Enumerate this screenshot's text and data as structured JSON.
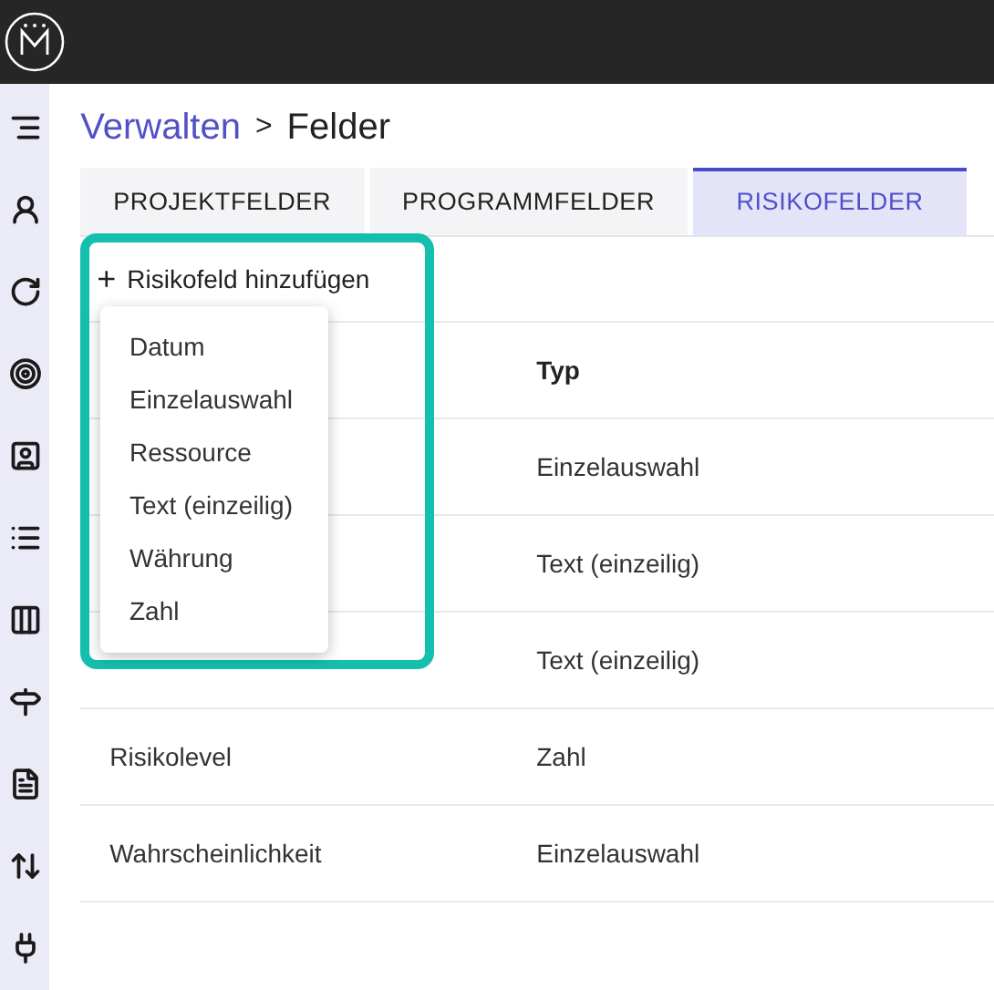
{
  "breadcrumb": {
    "parent": "Verwalten",
    "separator": ">",
    "current": "Felder"
  },
  "tabs": [
    {
      "label": "PROJEKTFELDER",
      "selected": false
    },
    {
      "label": "PROGRAMMFELDER",
      "selected": false
    },
    {
      "label": "RISIKOFELDER",
      "selected": true
    }
  ],
  "add_button": {
    "icon": "+",
    "label": "Risikofeld hinzufügen"
  },
  "add_menu": {
    "items": [
      "Datum",
      "Einzelauswahl",
      "Ressource",
      "Text (einzeilig)",
      "Währung",
      "Zahl"
    ]
  },
  "table": {
    "column_2_header": "Typ",
    "rows": [
      {
        "type": "Einzelauswahl"
      },
      {
        "type": "Text (einzeilig)"
      },
      {
        "type": "Text (einzeilig)"
      },
      {
        "name": "Risikolevel",
        "type": "Zahl"
      },
      {
        "name": "Wahrscheinlichkeit",
        "type": "Einzelauswahl"
      }
    ]
  }
}
